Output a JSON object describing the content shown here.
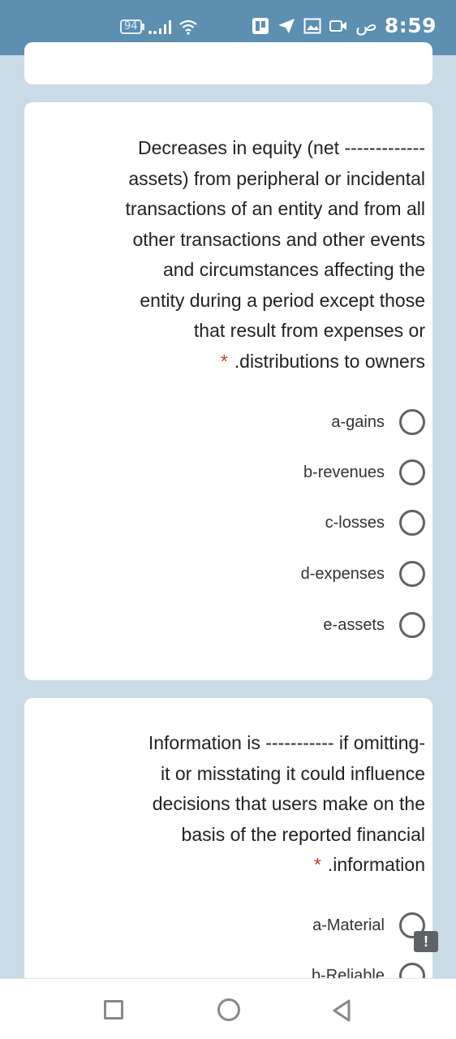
{
  "status_bar": {
    "battery": "94",
    "time": "8:59",
    "ampm": "ص"
  },
  "questions": [
    {
      "text_lines": [
        "Decreases in equity (net -------------",
        "assets) from peripheral or incidental",
        "transactions of an entity and from all",
        "other transactions and other events",
        "and circumstances affecting the",
        "entity during a period except those",
        "that result from expenses or",
        ".distributions to owners"
      ],
      "required_marker": "*",
      "options": [
        "a-gains",
        "b-revenues",
        "c-losses",
        "d-expenses",
        "e-assets"
      ]
    },
    {
      "text_lines": [
        "Information is ----------- if omitting-",
        "it or misstating it could influence",
        "decisions that users make on the",
        "basis of the reported financial",
        ".information"
      ],
      "required_marker": "*",
      "options": [
        "a-Material",
        "b-Reliable"
      ]
    }
  ],
  "feedback_icon": "!",
  "colors": {
    "status_bar": "#5c8fb0",
    "background": "#c9dbe6",
    "required": "#d93025"
  }
}
